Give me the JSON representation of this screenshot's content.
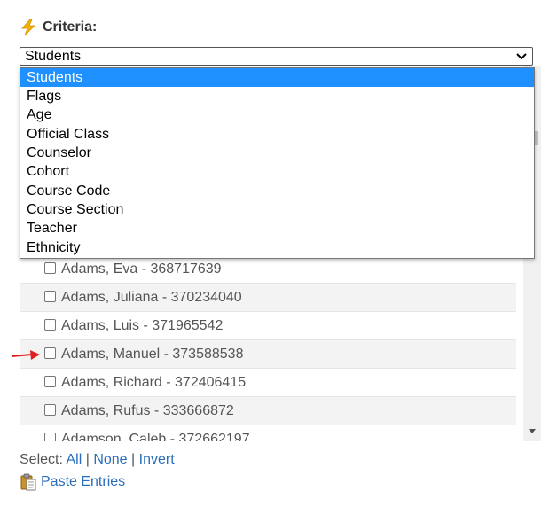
{
  "criteria": {
    "label": "Criteria:"
  },
  "select": {
    "value": "Students",
    "options": [
      "Students",
      "Flags",
      "Age",
      "Official Class",
      "Counselor",
      "Cohort",
      "Course Code",
      "Course Section",
      "Teacher",
      "Ethnicity"
    ]
  },
  "list": {
    "rows": [
      "Adams, Eva - 368717639",
      "Adams, Juliana - 370234040",
      "Adams, Luis - 371965542",
      "Adams, Manuel - 373588538",
      "Adams, Richard - 372406415",
      "Adams, Rufus - 333666872",
      "Adamson, Caleb - 372662197"
    ]
  },
  "selection": {
    "prefix": "Select:",
    "all": "All",
    "none": "None",
    "invert": "Invert",
    "sep": "|"
  },
  "paste": {
    "label": "Paste Entries"
  },
  "colors": {
    "accent": "#1e90ff",
    "link": "#2a6ebb",
    "pointer": "#e02020",
    "bolt": "#f4b400"
  }
}
